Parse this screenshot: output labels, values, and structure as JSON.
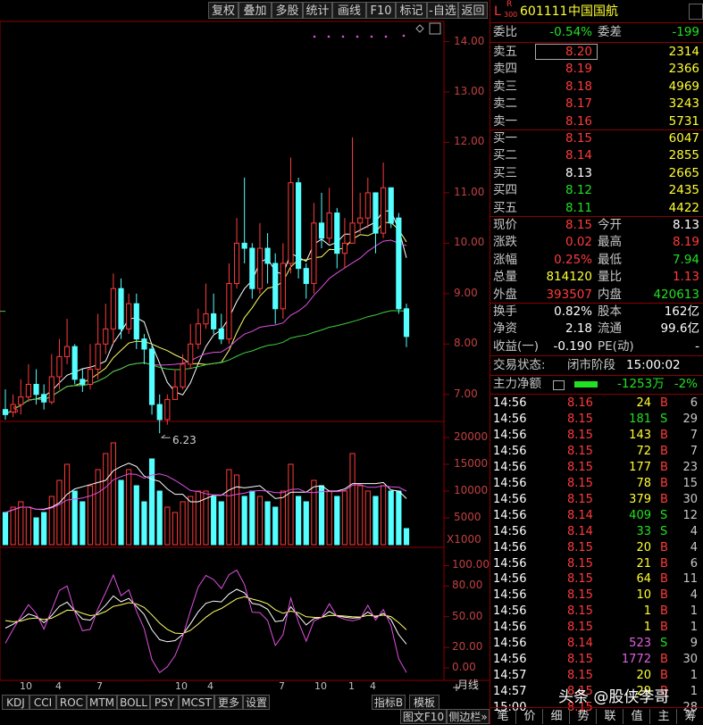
{
  "toolbar": {
    "buttons": [
      "复权",
      "叠加",
      "多股",
      "统计",
      "画线",
      "F10",
      "标记",
      "-自选",
      "返回"
    ]
  },
  "price_axis": [
    "14.00",
    "13.00",
    "12.00",
    "11.00",
    "10.00",
    "9.00",
    "8.00",
    "7.00"
  ],
  "volume_axis": [
    "20000",
    "15000",
    "10000",
    "5000"
  ],
  "volume_unit": "X1000",
  "kdj_axis": [
    "100.00",
    "80.00",
    "50.00",
    "20.00",
    "0.00"
  ],
  "low_marker": "6.23",
  "stock": {
    "market_badge_top": "R",
    "market_badge_bottom": "300",
    "code": "601111",
    "name": "中国国航",
    "letter": "L"
  },
  "weibi": {
    "label1": "委比",
    "value1": "-0.54%",
    "label2": "委差",
    "value2": "-199"
  },
  "sell": [
    {
      "label": "卖五",
      "price": "8.20",
      "vol": "2314"
    },
    {
      "label": "卖四",
      "price": "8.19",
      "vol": "2366"
    },
    {
      "label": "卖三",
      "price": "8.18",
      "vol": "4969"
    },
    {
      "label": "卖二",
      "price": "8.17",
      "vol": "3243"
    },
    {
      "label": "卖一",
      "price": "8.16",
      "vol": "5731"
    }
  ],
  "buy": [
    {
      "label": "买一",
      "price": "8.15",
      "vol": "6047"
    },
    {
      "label": "买二",
      "price": "8.14",
      "vol": "2855"
    },
    {
      "label": "买三",
      "price": "8.13",
      "vol": "2665"
    },
    {
      "label": "买四",
      "price": "8.12",
      "vol": "2435"
    },
    {
      "label": "买五",
      "price": "8.11",
      "vol": "4422"
    }
  ],
  "quote": [
    {
      "l1": "现价",
      "v1": "8.15",
      "l2": "今开",
      "v2": "8.13"
    },
    {
      "l1": "涨跌",
      "v1": "0.02",
      "l2": "最高",
      "v2": "8.19"
    },
    {
      "l1": "涨幅",
      "v1": "0.25%",
      "l2": "最低",
      "v2": "7.94"
    },
    {
      "l1": "总量",
      "v1": "814120",
      "l2": "量比",
      "v2": "1.13"
    },
    {
      "l1": "外盘",
      "v1": "393507",
      "l2": "内盘",
      "v2": "420613"
    }
  ],
  "fundamentals": [
    {
      "l1": "换手",
      "v1": "0.82%",
      "l2": "股本",
      "v2": "162亿"
    },
    {
      "l1": "净资",
      "v1": "2.18",
      "l2": "流通",
      "v2": "99.6亿"
    },
    {
      "l1": "收益(一)",
      "v1": "-0.190",
      "l2": "PE(动)",
      "v2": "-"
    }
  ],
  "status": {
    "label": "交易状态:",
    "value": "闭市阶段",
    "time": "15:00:02"
  },
  "main_flow": {
    "label": "主力净额",
    "value": "-1253万",
    "pct": "-2%"
  },
  "ticks": [
    {
      "t": "14:56",
      "p": "8.16",
      "v": "24",
      "d": "B",
      "n": "6"
    },
    {
      "t": "14:56",
      "p": "8.15",
      "v": "181",
      "d": "S",
      "n": "29"
    },
    {
      "t": "14:56",
      "p": "8.15",
      "v": "143",
      "d": "B",
      "n": "7"
    },
    {
      "t": "14:56",
      "p": "8.15",
      "v": "72",
      "d": "B",
      "n": "7"
    },
    {
      "t": "14:56",
      "p": "8.15",
      "v": "177",
      "d": "B",
      "n": "23"
    },
    {
      "t": "14:56",
      "p": "8.15",
      "v": "78",
      "d": "B",
      "n": "15"
    },
    {
      "t": "14:56",
      "p": "8.15",
      "v": "379",
      "d": "B",
      "n": "30"
    },
    {
      "t": "14:56",
      "p": "8.14",
      "v": "409",
      "d": "S",
      "n": "12"
    },
    {
      "t": "14:56",
      "p": "8.14",
      "v": "33",
      "d": "S",
      "n": "4"
    },
    {
      "t": "14:56",
      "p": "8.15",
      "v": "20",
      "d": "B",
      "n": "4"
    },
    {
      "t": "14:56",
      "p": "8.15",
      "v": "21",
      "d": "B",
      "n": "6"
    },
    {
      "t": "14:56",
      "p": "8.15",
      "v": "64",
      "d": "B",
      "n": "11"
    },
    {
      "t": "14:56",
      "p": "8.15",
      "v": "10",
      "d": "B",
      "n": "4"
    },
    {
      "t": "14:56",
      "p": "8.15",
      "v": "1",
      "d": "B",
      "n": "1"
    },
    {
      "t": "14:56",
      "p": "8.15",
      "v": "1",
      "d": "B",
      "n": "1"
    },
    {
      "t": "14:56",
      "p": "8.14",
      "v": "523",
      "d": "S",
      "n": "9"
    },
    {
      "t": "14:56",
      "p": "8.15",
      "v": "1772",
      "d": "B",
      "n": "30"
    },
    {
      "t": "14:57",
      "p": "8.15",
      "v": "20",
      "d": "B",
      "n": "1"
    },
    {
      "t": "14:57",
      "p": "8.15",
      "v": "29",
      "d": "B",
      "n": "1"
    },
    {
      "t": "15:00",
      "p": "8.15",
      "v": "",
      "d": "",
      "n": "28"
    }
  ],
  "bottom_tabs": [
    "KDJ",
    "CCI",
    "ROC",
    "MTM",
    "BOLL",
    "PSY",
    "MCST",
    "更多",
    "设置"
  ],
  "bottom_right": {
    "indicator": "指标B",
    "template": "模板",
    "plus": "+",
    "minus": "-",
    "period": "月线",
    "sidebar": "图文F10",
    "sidebar2": "侧边栏»"
  },
  "panel_tabs": [
    "笔",
    "价",
    "细",
    "势",
    "联",
    "值",
    "主",
    "筹"
  ],
  "month_marks": [
    "10",
    "4",
    "7",
    "10",
    "4",
    "7",
    "10",
    "1",
    "4"
  ],
  "watermark": "头条 @股侠李哥",
  "colors": {
    "up": "#ff3b3b",
    "down": "#55ffff",
    "frame": "#8b0000"
  },
  "chart_data": {
    "type": "candlestick",
    "ylim": [
      6.5,
      14.4
    ],
    "candles": [
      [
        6.7,
        6.6,
        7.1,
        6.5
      ],
      [
        6.65,
        6.8,
        7.0,
        6.55
      ],
      [
        6.8,
        6.95,
        7.3,
        6.6
      ],
      [
        6.95,
        7.2,
        7.6,
        6.85
      ],
      [
        7.2,
        7.0,
        7.5,
        6.8
      ],
      [
        7.0,
        6.85,
        7.2,
        6.7
      ],
      [
        6.85,
        7.35,
        7.8,
        6.8
      ],
      [
        7.35,
        7.75,
        8.1,
        7.1
      ],
      [
        7.75,
        7.95,
        8.5,
        7.6
      ],
      [
        7.95,
        7.3,
        8.0,
        7.2
      ],
      [
        7.3,
        7.2,
        7.5,
        7.05
      ],
      [
        7.2,
        7.5,
        8.0,
        7.1
      ],
      [
        7.5,
        8.0,
        8.6,
        7.3
      ],
      [
        8.0,
        8.3,
        8.8,
        7.8
      ],
      [
        8.3,
        9.1,
        9.4,
        8.0
      ],
      [
        9.1,
        8.3,
        9.3,
        8.1
      ],
      [
        8.3,
        8.8,
        9.0,
        8.2
      ],
      [
        8.8,
        8.1,
        9.0,
        7.9
      ],
      [
        8.1,
        7.9,
        8.2,
        7.6
      ],
      [
        7.9,
        6.8,
        8.0,
        6.6
      ],
      [
        6.8,
        6.5,
        7.0,
        6.23
      ],
      [
        6.5,
        6.9,
        7.0,
        6.4
      ],
      [
        6.9,
        7.15,
        7.5,
        6.9
      ],
      [
        7.15,
        7.6,
        7.8,
        7.1
      ],
      [
        7.6,
        8.0,
        8.4,
        7.5
      ],
      [
        8.0,
        8.4,
        8.7,
        7.9
      ],
      [
        8.4,
        8.6,
        9.2,
        8.3
      ],
      [
        8.6,
        8.3,
        9.0,
        8.2
      ],
      [
        8.3,
        8.1,
        8.6,
        8.0
      ],
      [
        8.1,
        9.2,
        9.6,
        8.0
      ],
      [
        9.2,
        10.0,
        10.5,
        9.1
      ],
      [
        10.0,
        9.9,
        11.3,
        9.6
      ],
      [
        9.9,
        9.1,
        10.0,
        8.9
      ],
      [
        9.1,
        9.9,
        10.4,
        9.0
      ],
      [
        9.9,
        9.6,
        10.2,
        9.2
      ],
      [
        9.6,
        8.7,
        9.8,
        8.4
      ],
      [
        8.7,
        9.6,
        10.0,
        8.5
      ],
      [
        9.6,
        11.2,
        11.7,
        9.4
      ],
      [
        11.2,
        9.5,
        11.3,
        9.3
      ],
      [
        9.5,
        9.2,
        9.6,
        8.9
      ],
      [
        9.2,
        10.4,
        10.8,
        9.0
      ],
      [
        10.4,
        10.1,
        11.0,
        9.9
      ],
      [
        10.1,
        10.6,
        11.1,
        10.0
      ],
      [
        10.6,
        9.8,
        10.7,
        9.5
      ],
      [
        9.8,
        10.0,
        10.5,
        9.5
      ],
      [
        10.0,
        10.4,
        12.1,
        10.0
      ],
      [
        10.4,
        10.5,
        11.0,
        10.2
      ],
      [
        10.5,
        11.0,
        11.3,
        10.3
      ],
      [
        11.0,
        10.2,
        11.0,
        9.8
      ],
      [
        10.2,
        11.1,
        11.6,
        10.1
      ],
      [
        11.1,
        10.4,
        11.1,
        10.3
      ],
      [
        10.5,
        8.7,
        10.6,
        8.6
      ],
      [
        8.7,
        8.15,
        8.8,
        7.94
      ]
    ],
    "volume": [
      6,
      7,
      8,
      7,
      5,
      6,
      9,
      12,
      15,
      10,
      8,
      11,
      14,
      17,
      19,
      12,
      14,
      11,
      8,
      16,
      10,
      7,
      6,
      8,
      9,
      10,
      10,
      9,
      8,
      14,
      13,
      9,
      10,
      9,
      8,
      7,
      10,
      15,
      9,
      8,
      12,
      11,
      10,
      9,
      10,
      17,
      11,
      10,
      9,
      11,
      10,
      10,
      3
    ]
  }
}
